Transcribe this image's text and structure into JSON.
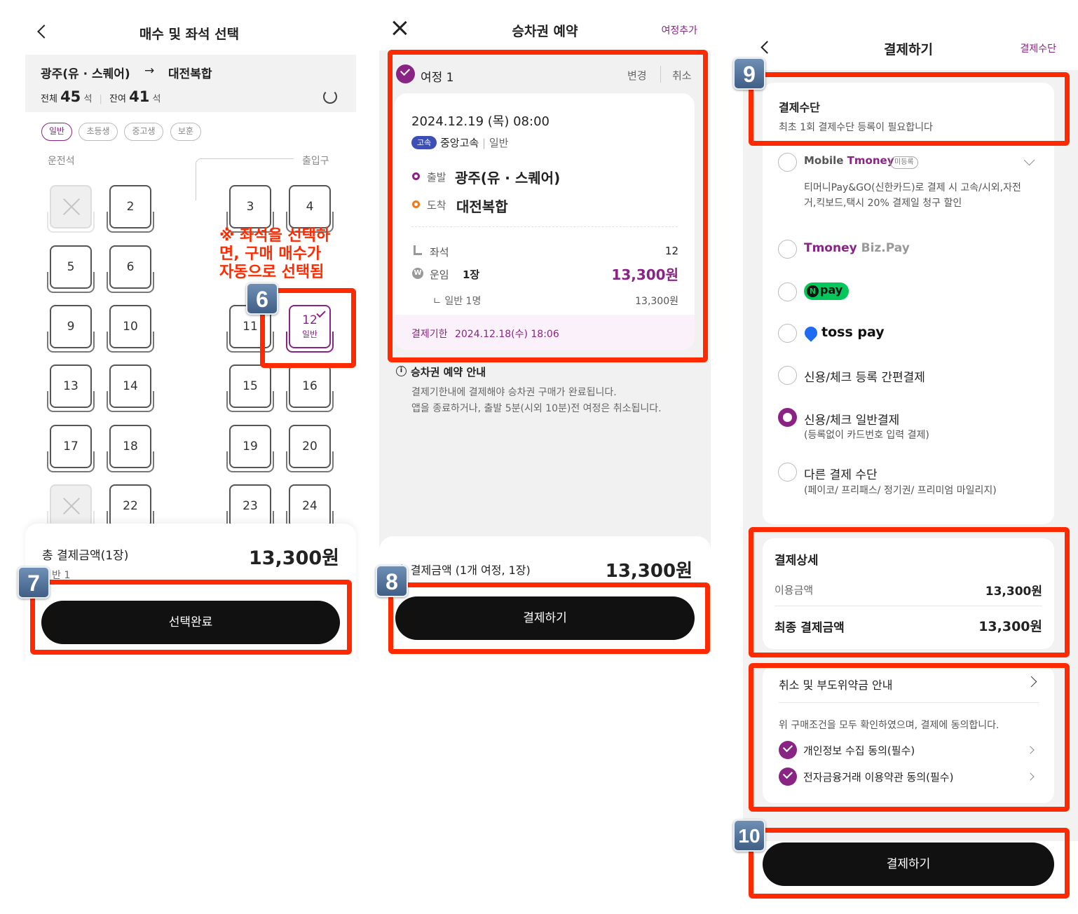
{
  "screen1": {
    "title": "매수 및 좌석 선택",
    "route_from": "광주(유 · 스퀘어)",
    "route_arrow": "→",
    "route_to": "대전복합",
    "total_label": "전체",
    "total_count": "45",
    "remain_label": "잔여",
    "remain_count": "41",
    "seat_unit": "석",
    "chips": [
      "일반",
      "초등생",
      "중고생",
      "보훈"
    ],
    "driver_label": "운전석",
    "entrance_label": "출입구",
    "seats": {
      "s2": "2",
      "s3": "3",
      "s4": "4",
      "s5": "5",
      "s6": "6",
      "s9": "9",
      "s10": "10",
      "s11": "11",
      "s12": "12",
      "s13": "13",
      "s14": "14",
      "s15": "15",
      "s16": "16",
      "s17": "17",
      "s18": "18",
      "s19": "19",
      "s20": "20",
      "s22": "22",
      "s23": "23",
      "s24": "24"
    },
    "selected_seat_type": "일반",
    "note_line1": "※ 좌석을 선택하",
    "note_line2": "면, 구매 매수가",
    "note_line3": "자동으로 선택됨",
    "footer_label": "총 결제금액(1장)",
    "footer_amount": "13,300원",
    "footer_sub": "반 1",
    "button_label": "선택완료",
    "badge_6": "6",
    "badge_7": "7"
  },
  "screen2": {
    "title": "승차권 예약",
    "add_trip": "여정추가",
    "trip_label": "여정 1",
    "change": "변경",
    "cancel": "취소",
    "datetime": "2024.12.19 (목) 08:00",
    "bus_badge": "고속",
    "company": "중앙고속",
    "grade_sep": "|",
    "grade": "일반",
    "depart_label": "출발",
    "depart_name": "광주(유 · 스퀘어)",
    "arrive_label": "도착",
    "arrive_name": "대전복합",
    "seat_label": "좌석",
    "seat_value": "12",
    "fare_label": "운임",
    "fare_count": "1장",
    "fare_amount": "13,300원",
    "fare_detail_label": "ㄴ 일반 1명",
    "fare_detail_amount": "13,300원",
    "deadline_label": "결제기한",
    "deadline_value": "2024.12.18(수) 18:06",
    "notice_title": "승차권 예약 안내",
    "notice_line1": "결제기한내에 결제해야 승차권 구매가 완료됩니다.",
    "notice_line2": "앱을 종료하거나, 출발 5분(시외 10분)전 여정은 취소됩니다.",
    "footer_label": "총 결제금액 (1개 여정, 1장)",
    "footer_amount": "13,300원",
    "button_label": "결제하기",
    "badge_8": "8"
  },
  "screen3": {
    "title": "결제하기",
    "header_right": "결제수단",
    "method_title": "결제수단",
    "method_sub": "최초 1회 결제수단 등록이 필요합니다",
    "tmoney_mobile": "Mobile",
    "tmoney_brand": "Tmoney",
    "tmoney_tag": "미등록",
    "tmoney_desc1": "티머니Pay&GO(신한카드)로 결제 시 고속/시외,자전",
    "tmoney_desc2": "거,킥보드,택시 20% 결제일 청구 할인",
    "biz_brand": "Tmoney",
    "biz_suffix": "Biz.Pay",
    "npay_n": "N",
    "npay_text": "pay",
    "toss_text": "toss pay",
    "opt_simple": "신용/체크 등록 간편결제",
    "opt_general": "신용/체크 일반결제",
    "opt_general_sub": "(등록없이 카드번호 입력 결제)",
    "opt_other": "다른 결제 수단",
    "opt_other_sub": "(페이코/ 프리패스/ 정기권/ 프리미엄 마일리지)",
    "detail_title": "결제상세",
    "use_amount_label": "이용금액",
    "use_amount": "13,300원",
    "final_label": "최종 결제금액",
    "final_amount": "13,300원",
    "cancel_policy": "취소 및 부도위약금 안내",
    "agree_text": "위 구매조건을 모두 확인하였으며, 결제에 동의합니다.",
    "agree1": "개인정보 수집 동의(필수)",
    "agree2": "전자금융거래 이용약관 동의(필수)",
    "button_label": "결제하기",
    "badge_9": "9",
    "badge_10": "10"
  },
  "colors": {
    "accent": "#8a2484",
    "annotation": "#ff2a00",
    "badge_blue": "#3f5f86",
    "bus_badge": "#3d4fb5",
    "depart": "#8a2484",
    "arrive": "#f07a1a",
    "npay_green": "#03c75a",
    "toss_blue": "#1e6cf2"
  }
}
